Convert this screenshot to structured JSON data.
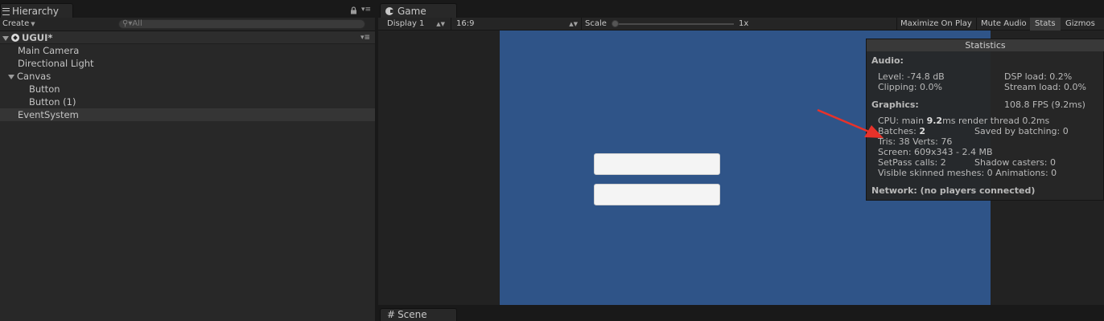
{
  "hierarchy": {
    "tab_label": "Hierarchy",
    "create_label": "Create",
    "search_placeholder": "All",
    "scene_name": "UGUI*",
    "items": [
      {
        "label": "Main Camera"
      },
      {
        "label": "Directional Light"
      },
      {
        "label": "Canvas"
      },
      {
        "label": "Button"
      },
      {
        "label": "Button (1)"
      },
      {
        "label": "EventSystem"
      }
    ]
  },
  "game": {
    "tab_label": "Game",
    "display": "Display 1",
    "aspect": "16:9",
    "scale_label": "Scale",
    "scale_value": "1x",
    "maximize_on_play": "Maximize On Play",
    "mute_audio": "Mute Audio",
    "stats": "Stats",
    "gizmos": "Gizmos"
  },
  "statistics": {
    "title": "Statistics",
    "audio_header": "Audio:",
    "level": "Level: -74.8 dB",
    "clipping": "Clipping: 0.0%",
    "dsp_load": "DSP load: 0.2%",
    "stream_load": "Stream load: 0.0%",
    "graphics_header": "Graphics:",
    "fps": "108.8 FPS (9.2ms)",
    "cpu_prefix": "CPU: main",
    "cpu_main": "9.2",
    "cpu_suffix": "ms  render thread 0.2ms",
    "batches_prefix": "Batches:",
    "batches": "2",
    "saved_by_batching": "Saved by batching: 0",
    "tris_verts": "Tris: 38   Verts: 76",
    "screen": "Screen: 609x343 - 2.4 MB",
    "setpass": "SetPass calls: 2",
    "shadow_casters": "Shadow casters: 0",
    "skinned_meshes": "Visible skinned meshes: 0  Animations: 0",
    "network": "Network: (no players connected)"
  },
  "scene": {
    "tab_label": "Scene"
  },
  "colors": {
    "game_background": "#2f5488",
    "arrow": "#e8322a",
    "editor_dark": "#282828"
  }
}
